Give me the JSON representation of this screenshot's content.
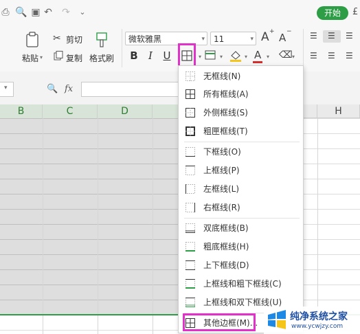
{
  "topbar": {
    "start_label": "开始",
    "cut_glyph": "£"
  },
  "clipboard": {
    "paste": "粘贴",
    "cut": "剪切",
    "copy": "复制",
    "format_painter": "格式刷"
  },
  "font": {
    "name": "微软雅黑",
    "size": "11",
    "increase": "A",
    "decrease": "A"
  },
  "format": {
    "bold": "B",
    "italic": "I",
    "underline": "U",
    "font_color_letter": "A"
  },
  "formula_bar": {
    "fx": "fx"
  },
  "columns": [
    {
      "label": "B",
      "selected": true
    },
    {
      "label": "C",
      "selected": true
    },
    {
      "label": "D",
      "selected": true
    },
    {
      "label": "H",
      "selected": false
    }
  ],
  "border_menu": {
    "items": [
      {
        "label": "无框线(N)",
        "icon": "no-border-icon"
      },
      {
        "label": "所有框线(A)",
        "icon": "all-borders-icon"
      },
      {
        "label": "外侧框线(S)",
        "icon": "outside-borders-icon"
      },
      {
        "label": "粗匣框线(T)",
        "icon": "thick-box-border-icon"
      },
      {
        "label": "下框线(O)",
        "icon": "bottom-border-icon"
      },
      {
        "label": "上框线(P)",
        "icon": "top-border-icon"
      },
      {
        "label": "左框线(L)",
        "icon": "left-border-icon"
      },
      {
        "label": "右框线(R)",
        "icon": "right-border-icon"
      },
      {
        "label": "双底框线(B)",
        "icon": "double-bottom-border-icon"
      },
      {
        "label": "粗底框线(H)",
        "icon": "thick-bottom-border-icon"
      },
      {
        "label": "上下框线(D)",
        "icon": "top-bottom-border-icon"
      },
      {
        "label": "上框线和粗下框线(C)",
        "icon": "top-thick-bottom-border-icon"
      },
      {
        "label": "上框线和双下框线(U)",
        "icon": "top-double-bottom-border-icon"
      },
      {
        "label": "其他边框(M)...",
        "icon": "more-borders-icon"
      }
    ]
  },
  "watermark": {
    "title": "纯净系统之家",
    "url": "www.ycwjzy.com"
  },
  "colors": {
    "accent_green": "#2e9e46",
    "highlight": "#e032c8",
    "font_red": "#d32f2f",
    "fill_yellow": "#f5c518"
  }
}
